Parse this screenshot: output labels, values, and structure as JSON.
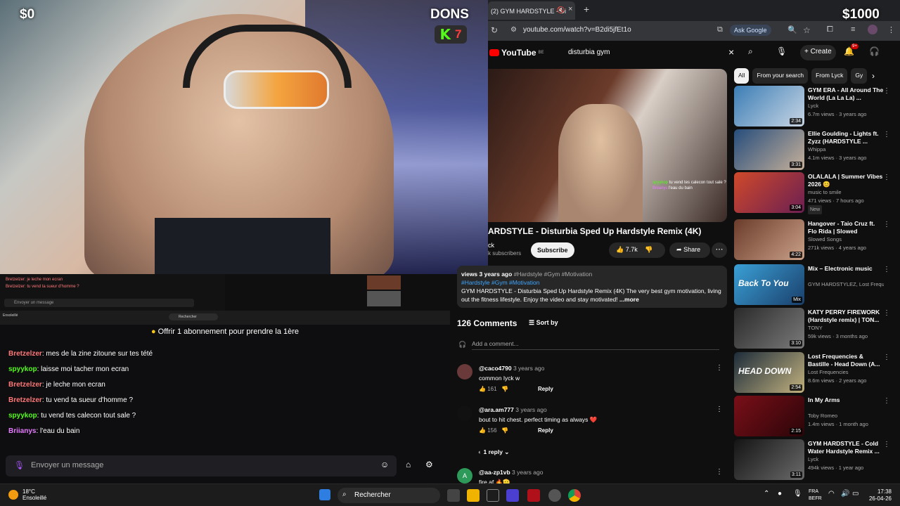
{
  "overlay": {
    "left_money": "$0",
    "dons_label": "DONS",
    "right_money": "$1000",
    "kick_letter": "K",
    "kick_count": "7"
  },
  "browser": {
    "tab_title": "(2) GYM HARDSTYLE - Di",
    "url": "youtube.com/watch?v=B2di5jfEt1o",
    "ask_google": "Ask Google"
  },
  "youtube": {
    "logo": "YouTube",
    "logo_region": "BE",
    "search_query": "disturbia gym",
    "create_label": "Create",
    "notif_count": "9+",
    "video_caption_user1": "spyykop",
    "video_caption_text1": "tu vend tes calecon tout sale ?",
    "video_caption_user2": "Briianys",
    "video_caption_text2": "l'eau du bain",
    "video_title": "ARDSTYLE - Disturbia Sped Up Hardstyle Remix (4K)",
    "channel": "ck",
    "subscribers": "k subscribers",
    "subscribe_label": "Subscribe",
    "likes": "7.7k",
    "share_label": "Share",
    "desc_views": "views",
    "desc_age": "3 years ago",
    "desc_tags_top": "#Hardstyle #Gym #Motivation",
    "desc_tags": "#Hardstyle #Gym #Motivation",
    "desc_text": "GYM HARDSTYLE - Disturbia Sped Up Hardstyle Remix (4K) The very best gym motivation, living out the fitness lifestyle. Enjoy the video and stay motivated!",
    "desc_more": "...more",
    "comments_count": "126 Comments",
    "sort_label": "Sort by",
    "add_comment": "Add a comment...",
    "comments": [
      {
        "user": "@caco4790",
        "age": "3 years ago",
        "text": "common lyck w",
        "likes": "161",
        "reply": "Reply"
      },
      {
        "user": "@ara.am777",
        "age": "3 years ago",
        "text": "bout to hit chest. perfect timing as always ❤️",
        "likes": "156",
        "reply": "Reply",
        "replies": "1 reply"
      },
      {
        "user": "@aa-zp1vb",
        "age": "3 years ago",
        "text": "fire af 🔥🫡"
      }
    ],
    "chips": [
      "All",
      "From your search",
      "From Lyck",
      "Gy"
    ],
    "related": [
      {
        "title": "GYM ERA - All Around The World (La La La) ...",
        "channel": "Lyck",
        "meta": "6.7m views · 3 years ago",
        "dur": "2:34",
        "c1": "#3b7db5",
        "c2": "#c9d6e4"
      },
      {
        "title": "Ellie Goulding - Lights ft. Zyzz (HARDSTYLE ...",
        "channel": "Whippa",
        "meta": "4.1m views · 3 years ago",
        "dur": "3:31",
        "c1": "#264d7c",
        "c2": "#c6b09a"
      },
      {
        "title": "OLALALA | Summer Vibes 2026 😊",
        "channel": "music to smile",
        "meta": "471 views · 7 hours ago",
        "dur": "3:04",
        "c1": "#d0492a",
        "c2": "#6b1f52",
        "new": "New"
      },
      {
        "title": "Hangover - Taio Cruz ft. Flo Rida | Slowed",
        "channel": "Slowed Songs",
        "meta": "271k views · 4 years ago",
        "dur": "4:22",
        "c1": "#6a3b2a",
        "c2": "#caa088"
      },
      {
        "title": "Mix – Electronic music",
        "channel": "GYM HARDSTYLEZ, Lost Freque...",
        "meta": "",
        "dur": "Mix",
        "c1": "#3aa0d6",
        "c2": "#1a3f6b",
        "overlay": "Back To You"
      },
      {
        "title": "KATY PERRY FIREWORK (Hardstyle remix) | TON...",
        "channel": "TONY",
        "meta": "59k views · 3 months ago",
        "dur": "3:10",
        "c1": "#2a2a2a",
        "c2": "#7a7a7a"
      },
      {
        "title": "Lost Frequencies & Bastille - Head Down (A...",
        "channel": "Lost Frequencies",
        "meta": "8.6m views · 2 years ago",
        "dur": "2:54",
        "c1": "#1d2c3a",
        "c2": "#c2b17e",
        "overlay": "HEAD DOWN"
      },
      {
        "title": "In My Arms",
        "channel": "Toby Romeo",
        "meta": "1.4m views · 1 month ago",
        "dur": "2:15",
        "c1": "#7a0f18",
        "c2": "#2a0508"
      },
      {
        "title": "GYM HARDSTYLE - Cold Water Hardstyle Remix ...",
        "channel": "Lyck",
        "meta": "494k views · 1 year ago",
        "dur": "3:11",
        "c1": "#141414",
        "c2": "#6a6a6a"
      }
    ]
  },
  "chat": {
    "offer": "Offrir 1 abonnement pour prendre la 1ère",
    "messages": [
      {
        "user": "Bretzelzer",
        "color": "#ff7878",
        "text": ": mes de la zine zitoune sur tes tété"
      },
      {
        "user": "spyykop",
        "color": "#53fc18",
        "text": ": laisse moi tacher mon ecran"
      },
      {
        "user": "Bretzelzer",
        "color": "#ff7878",
        "text": ": je leche mon ecran"
      },
      {
        "user": "Bretzelzer",
        "color": "#ff7878",
        "text": ": tu vend ta sueur d'homme ?"
      },
      {
        "user": "spyykop",
        "color": "#53fc18",
        "text": ": tu vend tes calecon tout sale ?"
      },
      {
        "user": "Briianys",
        "color": "#e67cff",
        "text": ": l'eau du bain"
      }
    ],
    "placeholder": "Envoyer un message"
  },
  "mini": {
    "line1": "Bretzelzer: je leche mon ecran",
    "line2": "Bretzelzer: tu vend ta sueur d'homme ?",
    "input": "Envoyer un message",
    "weather": "Ensoleillé",
    "search": "Rechercher"
  },
  "taskbar": {
    "temp": "18°C",
    "weather": "Ensoleillé",
    "search": "Rechercher",
    "lang1": "FRA",
    "lang2": "BEFR",
    "time": "17:38",
    "date": "26-04-26"
  }
}
